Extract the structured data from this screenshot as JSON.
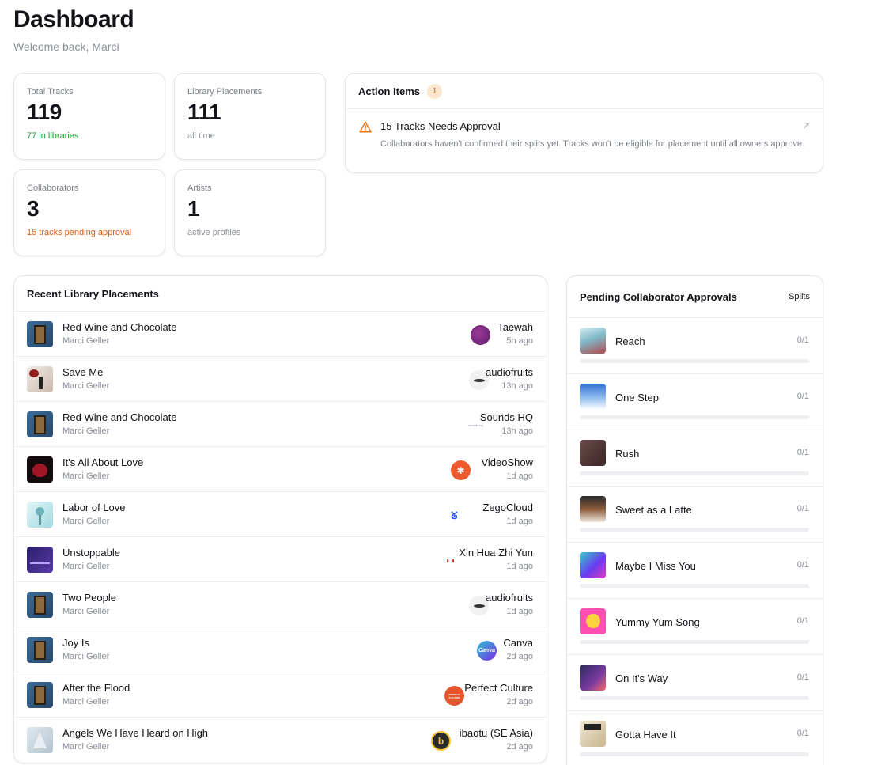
{
  "header": {
    "title": "Dashboard",
    "welcome": "Welcome back, Marci"
  },
  "stats": [
    {
      "label": "Total Tracks",
      "value": "119",
      "sub": "77 in libraries",
      "sub_color": "#1f9d3a"
    },
    {
      "label": "Library Placements",
      "value": "111",
      "sub": "all time",
      "sub_color": "#8a8f98"
    },
    {
      "label": "Collaborators",
      "value": "3",
      "sub": "15 tracks pending approval",
      "sub_color": "#e25a10"
    },
    {
      "label": "Artists",
      "value": "1",
      "sub": "active profiles",
      "sub_color": "#8a8f98"
    }
  ],
  "action_items": {
    "title": "Action Items",
    "count": "1",
    "items": [
      {
        "icon": "warning-icon",
        "heading": "15 Tracks Needs Approval",
        "description": "Collaborators haven't confirmed their splits yet. Tracks won't be eligible for placement until all owners approve."
      }
    ]
  },
  "recent_placements": {
    "title": "Recent Library Placements",
    "rows": [
      {
        "title": "Red Wine and Chocolate",
        "artist": "Marci Geller",
        "library": "Taewah",
        "time": "5h ago"
      },
      {
        "title": "Save Me",
        "artist": "Marci Geller",
        "library": "audiofruits",
        "time": "13h ago"
      },
      {
        "title": "Red Wine and Chocolate",
        "artist": "Marci Geller",
        "library": "Sounds HQ",
        "time": "13h ago"
      },
      {
        "title": "It's All About Love",
        "artist": "Marci Geller",
        "library": "VideoShow",
        "time": "1d ago"
      },
      {
        "title": "Labor of Love",
        "artist": "Marci Geller",
        "library": "ZegoCloud",
        "time": "1d ago"
      },
      {
        "title": "Unstoppable",
        "artist": "Marci Geller",
        "library": "Xin Hua Zhi Yun",
        "time": "1d ago"
      },
      {
        "title": "Two People",
        "artist": "Marci Geller",
        "library": "audiofruits",
        "time": "1d ago"
      },
      {
        "title": "Joy Is",
        "artist": "Marci Geller",
        "library": "Canva",
        "time": "2d ago"
      },
      {
        "title": "After the Flood",
        "artist": "Marci Geller",
        "library": "Perfect Culture",
        "time": "2d ago"
      },
      {
        "title": "Angels We Have Heard on High",
        "artist": "Marci Geller",
        "library": "ibaotu (SE Asia)",
        "time": "2d ago"
      }
    ]
  },
  "logo_text": {
    "sounds_hq": "sounds hq",
    "canva": "Canva",
    "perfect_culture": "PERFECT CULTURE",
    "ibaotu": "b"
  },
  "pending_approvals": {
    "title": "Pending Collaborator Approvals",
    "splits_label": "Splits",
    "rows": [
      {
        "title": "Reach",
        "count": "0/1",
        "progress": 0
      },
      {
        "title": "One Step",
        "count": "0/1",
        "progress": 0
      },
      {
        "title": "Rush",
        "count": "0/1",
        "progress": 0
      },
      {
        "title": "Sweet as a Latte",
        "count": "0/1",
        "progress": 0
      },
      {
        "title": "Maybe I Miss You",
        "count": "0/1",
        "progress": 0
      },
      {
        "title": "Yummy Yum Song",
        "count": "0/1",
        "progress": 0
      },
      {
        "title": "On It's Way",
        "count": "0/1",
        "progress": 0
      },
      {
        "title": "Gotta Have It",
        "count": "0/1",
        "progress": 0
      }
    ]
  },
  "colors": {
    "accent_orange": "#e25a10",
    "accent_green": "#1f9d3a",
    "badge_bg": "#fde6cf"
  }
}
